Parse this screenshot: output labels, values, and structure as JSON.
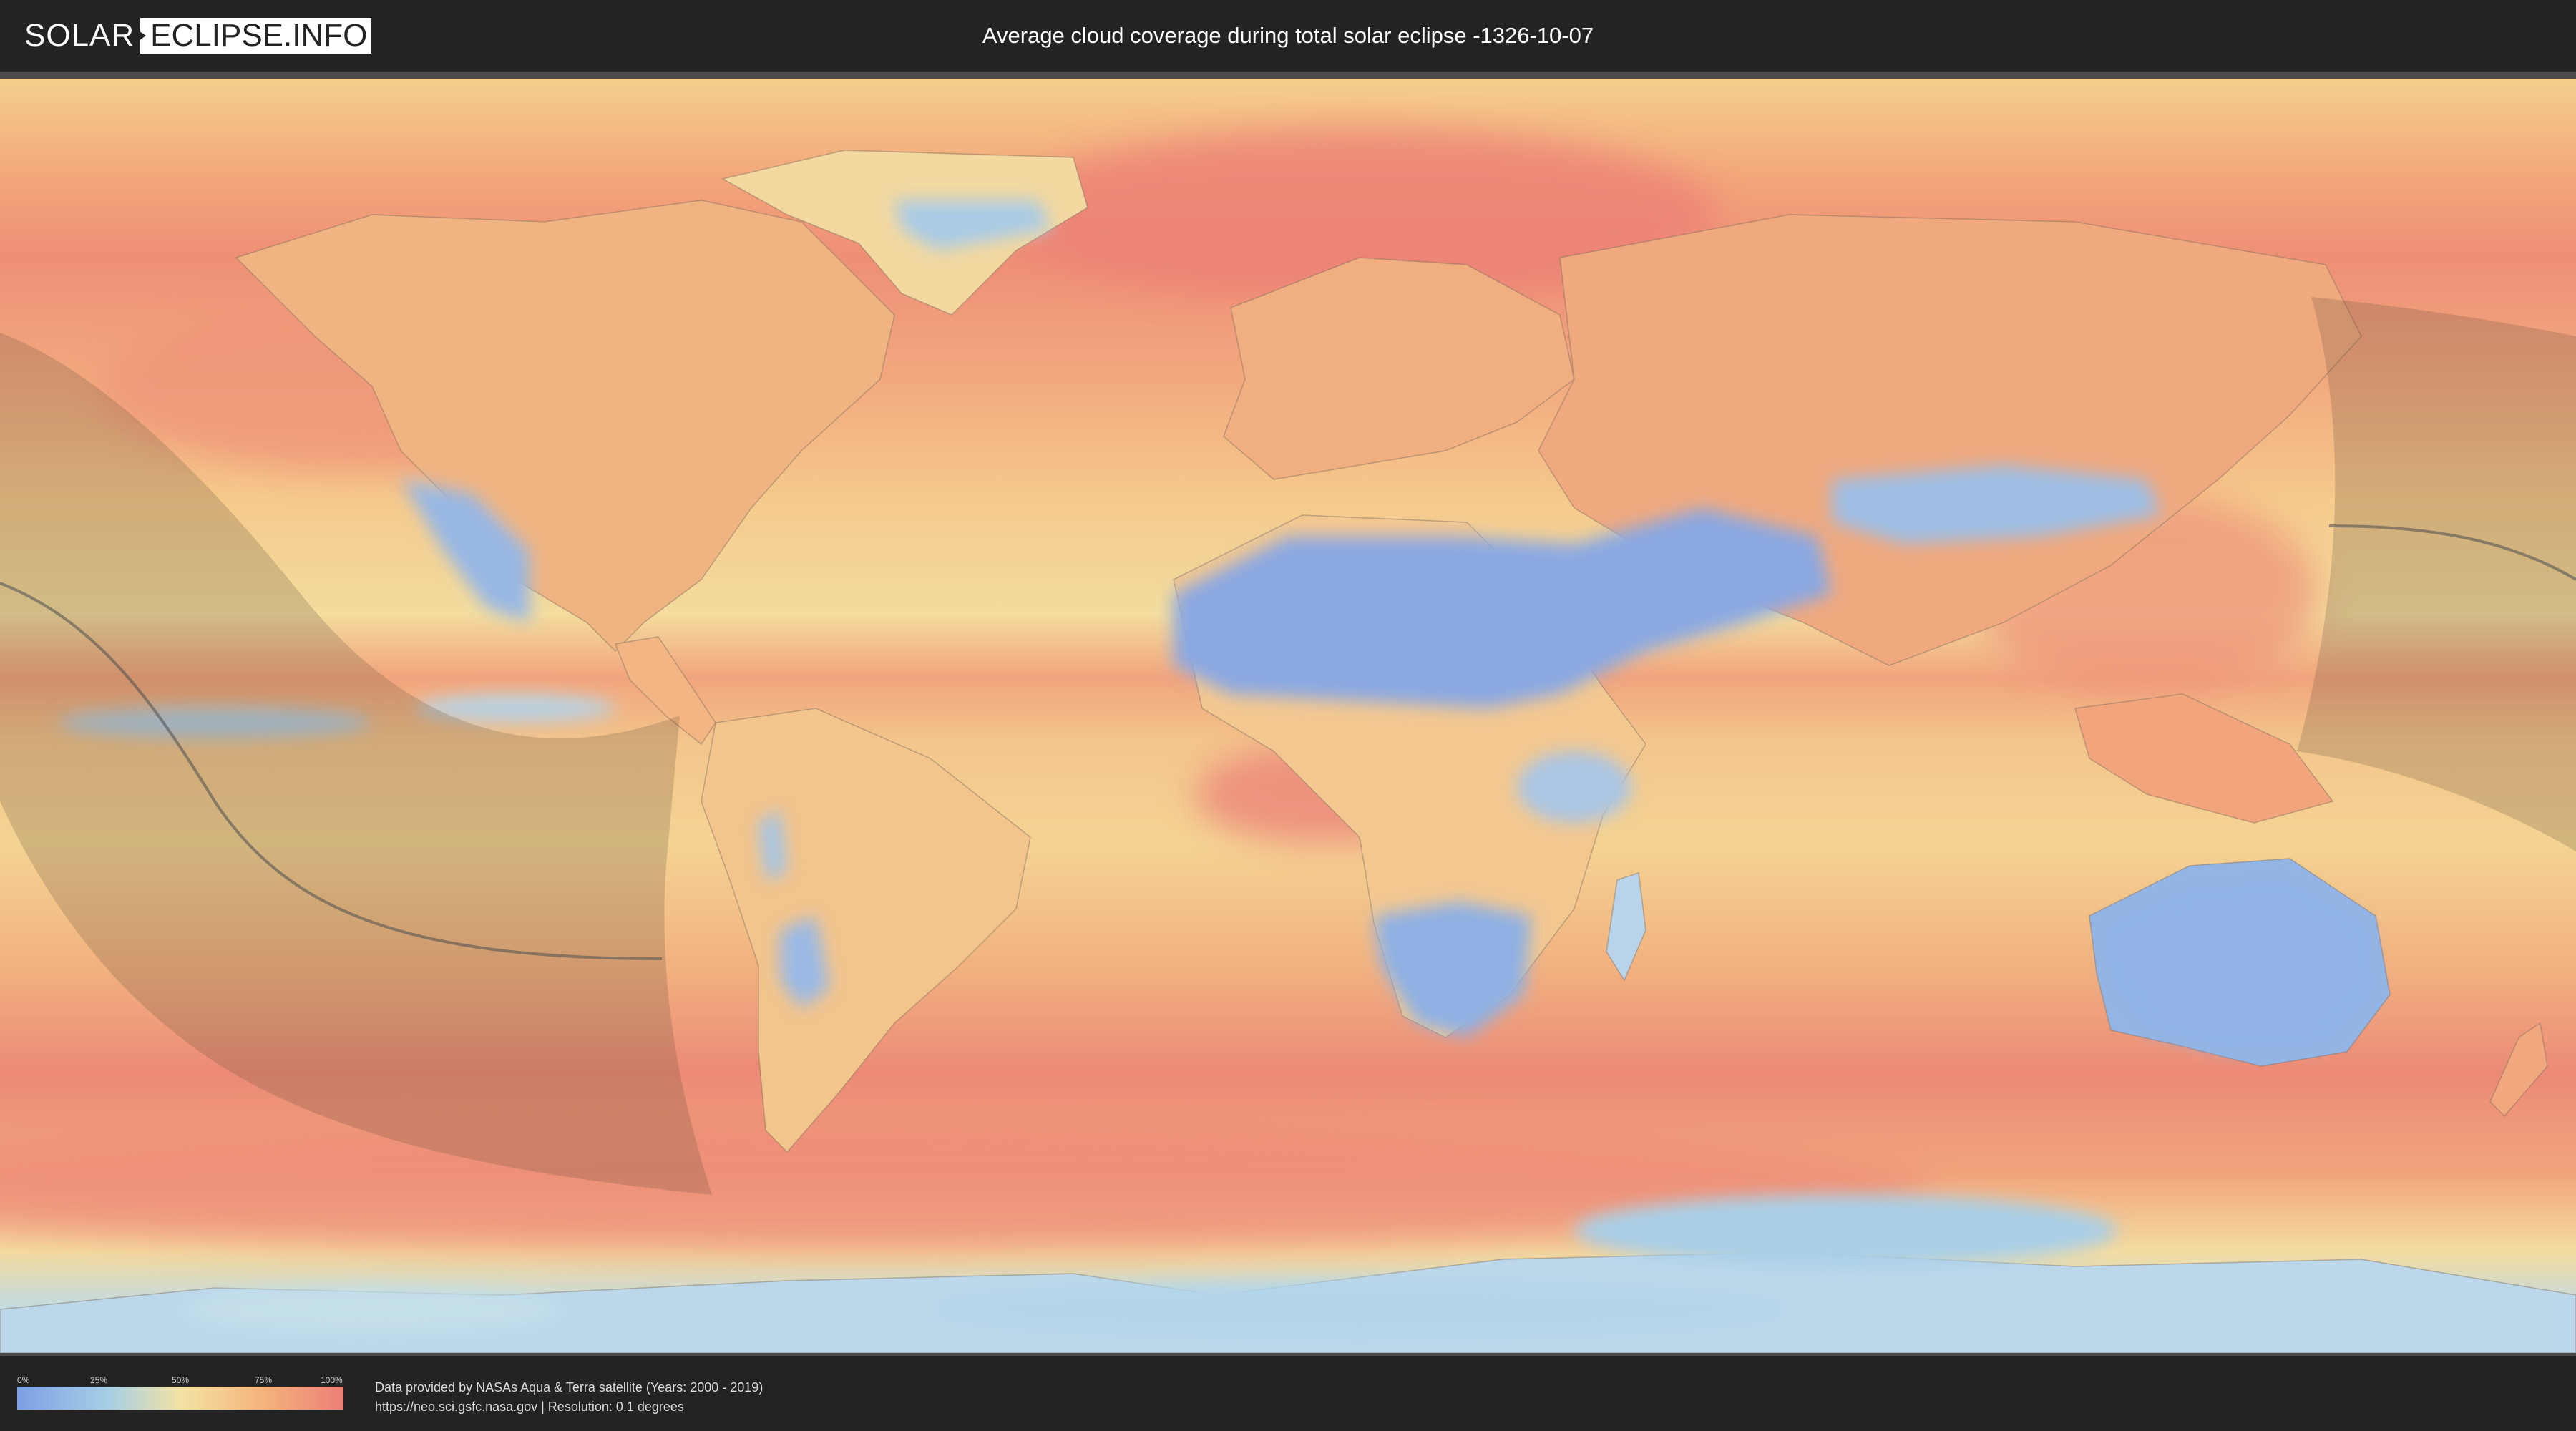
{
  "header": {
    "logo_solar": "SOLAR",
    "logo_eclipse": "ECLIPSE.INFO",
    "title": "Average cloud coverage during total solar eclipse -1326-10-07"
  },
  "legend": {
    "ticks": [
      "0%",
      "25%",
      "50%",
      "75%",
      "100%"
    ],
    "scale": [
      "#7d9fe4",
      "#a7cfe6",
      "#f3e2a4",
      "#f4b47c",
      "#ec7f78"
    ]
  },
  "credits": {
    "line1": "Data provided by NASAs Aqua & Terra satellite (Years: 2000 - 2019)",
    "line2": "https://neo.sci.gsfc.nasa.gov | Resolution: 0.1 degrees"
  },
  "colors": {
    "background": "#232323",
    "clear_sky": "#7d9fe4",
    "overcast": "#ec7f78",
    "eclipse_shadow": "#5a4a30",
    "central_line": "#555555"
  }
}
